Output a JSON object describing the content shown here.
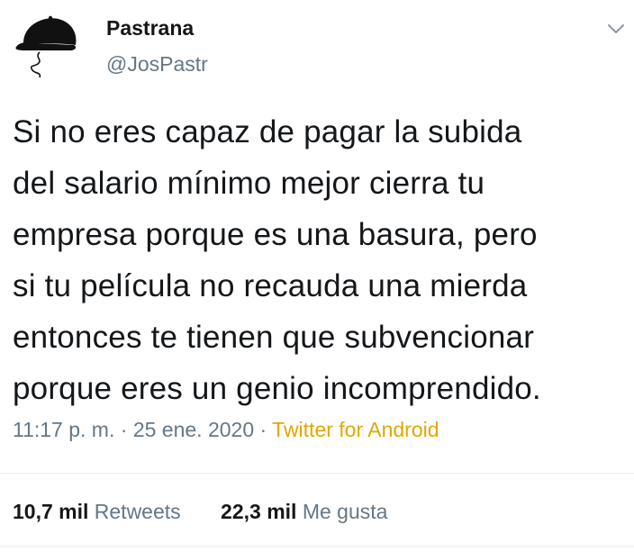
{
  "tweet": {
    "author_name": "Pastrana",
    "author_handle": "@JosPastr",
    "text": "Si no eres capaz de pagar la subida\ndel salario mínimo mejor cierra tu\nempresa porque es una basura, pero\nsi tu película no recauda una mierda\nentonces te tienen que subvencionar\nporque eres un genio incomprendido.",
    "time": "11:17 p. m.",
    "separator": "·",
    "date": "25 ene. 2020",
    "source": "Twitter for Android",
    "retweets_count": "10,7 mil",
    "retweets_label": "Retweets",
    "likes_count": "22,3 mil",
    "likes_label": "Me gusta"
  },
  "icons": {
    "avatar": "black-cap-avatar",
    "menu": "chevron-down-icon"
  },
  "colors": {
    "text": "#14171a",
    "secondary": "#657786",
    "source_link": "#e0a800",
    "divider": "#e6ecf0"
  }
}
